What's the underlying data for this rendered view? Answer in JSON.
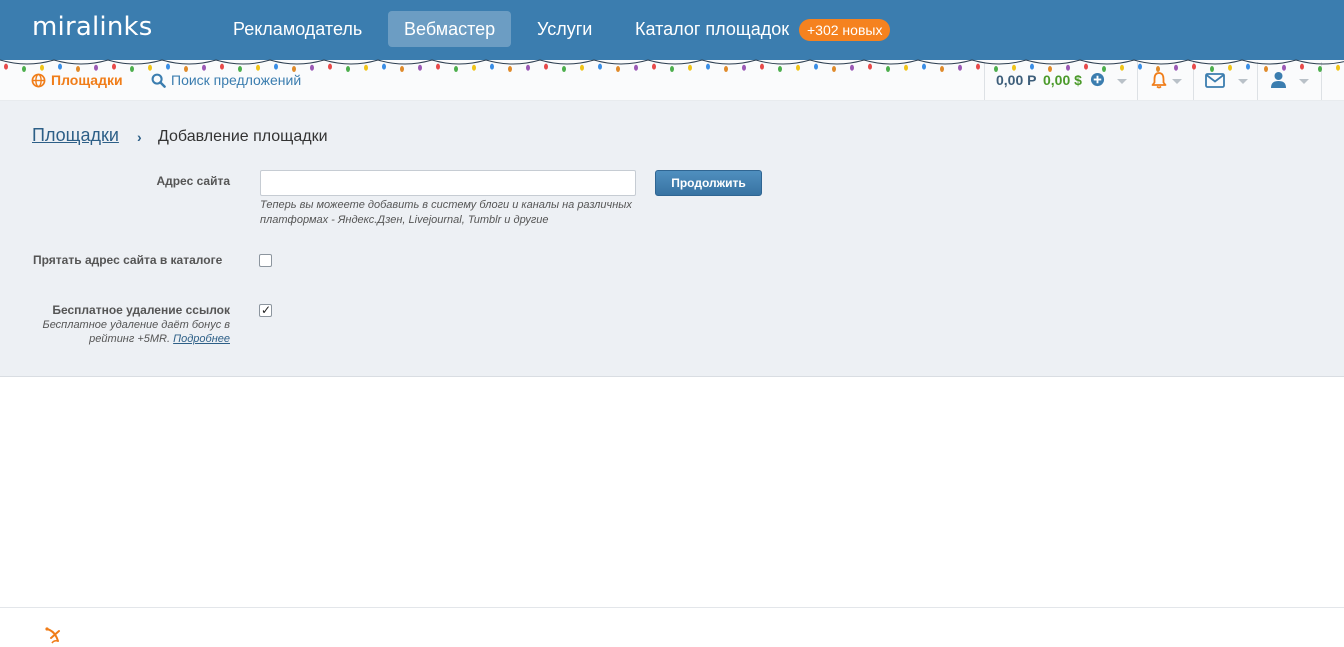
{
  "header": {
    "logo": "miralinks",
    "nav": {
      "advertiser": "Рекламодатель",
      "webmaster": "Вебмастер",
      "services": "Услуги",
      "catalog": "Каталог площадок"
    },
    "new_badge": "+302 новых"
  },
  "subbar": {
    "sites_link": "Площадки",
    "search_link": "Поиск предложений",
    "balance_rub": "0,00 Р",
    "balance_usd": "0,00 $"
  },
  "breadcrumb": {
    "root": "Площадки",
    "separator": "›",
    "current": "Добавление площадки"
  },
  "form": {
    "address_label": "Адрес сайта",
    "address_value": "",
    "address_placeholder": "",
    "continue_button": "Продолжить",
    "address_hint": "Теперь вы можеете добавить в систему блоги и каналы на различных платформах - Яндекс.Дзен, Livejournal, Tumblr и другие",
    "hide_label": "Прятать адрес сайта в каталоге",
    "hide_checked": false,
    "free_label": "Бесплатное удаление ссылок",
    "free_checked": true,
    "free_desc": "Бесплатное удаление даёт бонус в рейтинг +5MR.",
    "free_more": "Подробнее",
    "check_glyph": "✓"
  },
  "colors": {
    "header_bg": "#3b7daf",
    "accent_orange": "#f5821f",
    "link_blue": "#2d5f87",
    "usd_green": "#4b9a2a",
    "content_bg": "#edf0f4"
  },
  "icons": {
    "sites": "globe-icon",
    "search": "search-icon",
    "add_funds": "plus-circle-icon",
    "notifications": "bell-icon",
    "messages": "envelope-icon",
    "profile": "user-icon",
    "footer": "satellite-icon"
  }
}
